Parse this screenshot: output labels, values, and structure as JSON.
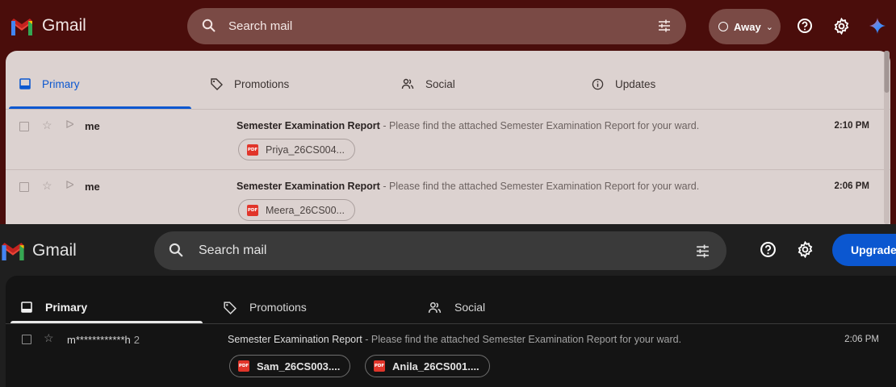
{
  "top": {
    "app_name": "Gmail",
    "search_placeholder": "Search mail",
    "status_label": "Away",
    "tabs": [
      {
        "label": "Primary"
      },
      {
        "label": "Promotions"
      },
      {
        "label": "Social"
      },
      {
        "label": "Updates"
      }
    ],
    "emails": [
      {
        "sender": "me",
        "subject": "Semester Examination Report",
        "snippet": " - Please find the attached Semester Examination Report for your ward.",
        "time": "2:10 PM",
        "attachment": "Priya_26CS004..."
      },
      {
        "sender": "me",
        "subject": "Semester Examination Report",
        "snippet": " - Please find the attached Semester Examination Report for your ward.",
        "time": "2:06 PM",
        "attachment": "Meera_26CS00..."
      }
    ],
    "colors": {
      "accent": "#0b57d0",
      "header_bg": "#4a0d0b",
      "list_bg": "#dcd2d0"
    }
  },
  "bottom": {
    "app_name": "Gmail",
    "search_placeholder": "Search mail",
    "upgrade_label": "Upgrade",
    "tabs": [
      {
        "label": "Primary"
      },
      {
        "label": "Promotions"
      },
      {
        "label": "Social"
      }
    ],
    "email": {
      "sender": "m************h",
      "count": "2",
      "subject": "Semester Examination Report",
      "snippet": " - Please find the attached Semester Examination Report for your ward.",
      "time": "2:06 PM",
      "attachments": [
        "Sam_26CS003....",
        "Anila_26CS001...."
      ]
    },
    "colors": {
      "accent": "#0b57d0",
      "bg": "#1f1f1f"
    }
  },
  "icons": {
    "logo": "gmail-m-icon",
    "search": "search-icon",
    "filter": "tune-icon",
    "help": "help-icon",
    "settings": "gear-icon",
    "gemini": "sparkle-icon",
    "pdf": "pdf-icon"
  },
  "pdf_label": "PDF"
}
